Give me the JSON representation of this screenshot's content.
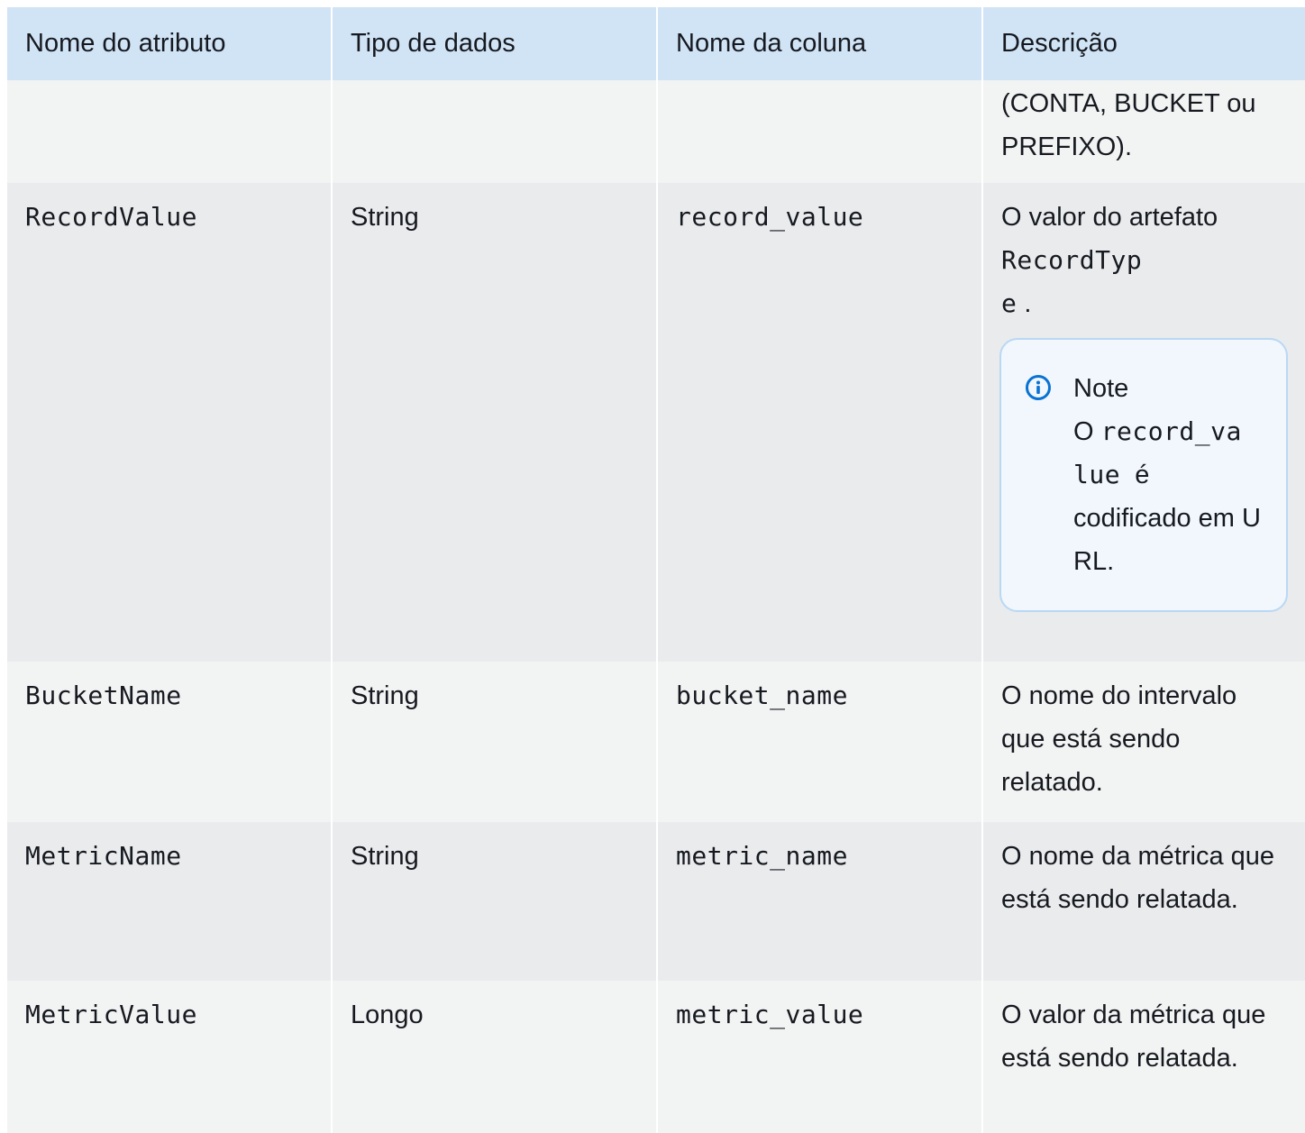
{
  "table": {
    "headers": [
      "Nome do atributo",
      "Tipo de dados",
      "Nome da coluna",
      "Descrição"
    ],
    "continued_row": {
      "description_line1": "(CONTA, BUCKET ou",
      "description_line2": "PREFIXO)."
    },
    "rows": [
      {
        "attribute": "RecordValue",
        "type": "String",
        "column": "record_value",
        "description_prefix": "O valor do artefato",
        "description_code_line1": "RecordTyp",
        "description_code_line2": "e",
        "description_suffix": ".",
        "note": {
          "title": "Note",
          "text_prefix": "O",
          "code_line1": "record_va",
          "code_line2": "lue",
          "text_middle": "é",
          "text_rest": "codificado em URL."
        }
      },
      {
        "attribute": "BucketName",
        "type": "String",
        "column": "bucket_name",
        "description": "O nome do intervalo que está sendo relatado."
      },
      {
        "attribute": "MetricName",
        "type": "String",
        "column": "metric_name",
        "description": "O nome da métrica que está sendo relatada."
      },
      {
        "attribute": "MetricValue",
        "type": "Longo",
        "column": "metric_value",
        "description": "O valor da métrica que está sendo relatada."
      }
    ]
  },
  "colors": {
    "header_bg": "#d1e4f6",
    "row_light": "#f2f3f3",
    "row_dark": "#e9ebed",
    "note_border": "#b9d8f4",
    "note_icon": "#0972d3"
  },
  "icons": {
    "note": "info-circle-icon"
  }
}
